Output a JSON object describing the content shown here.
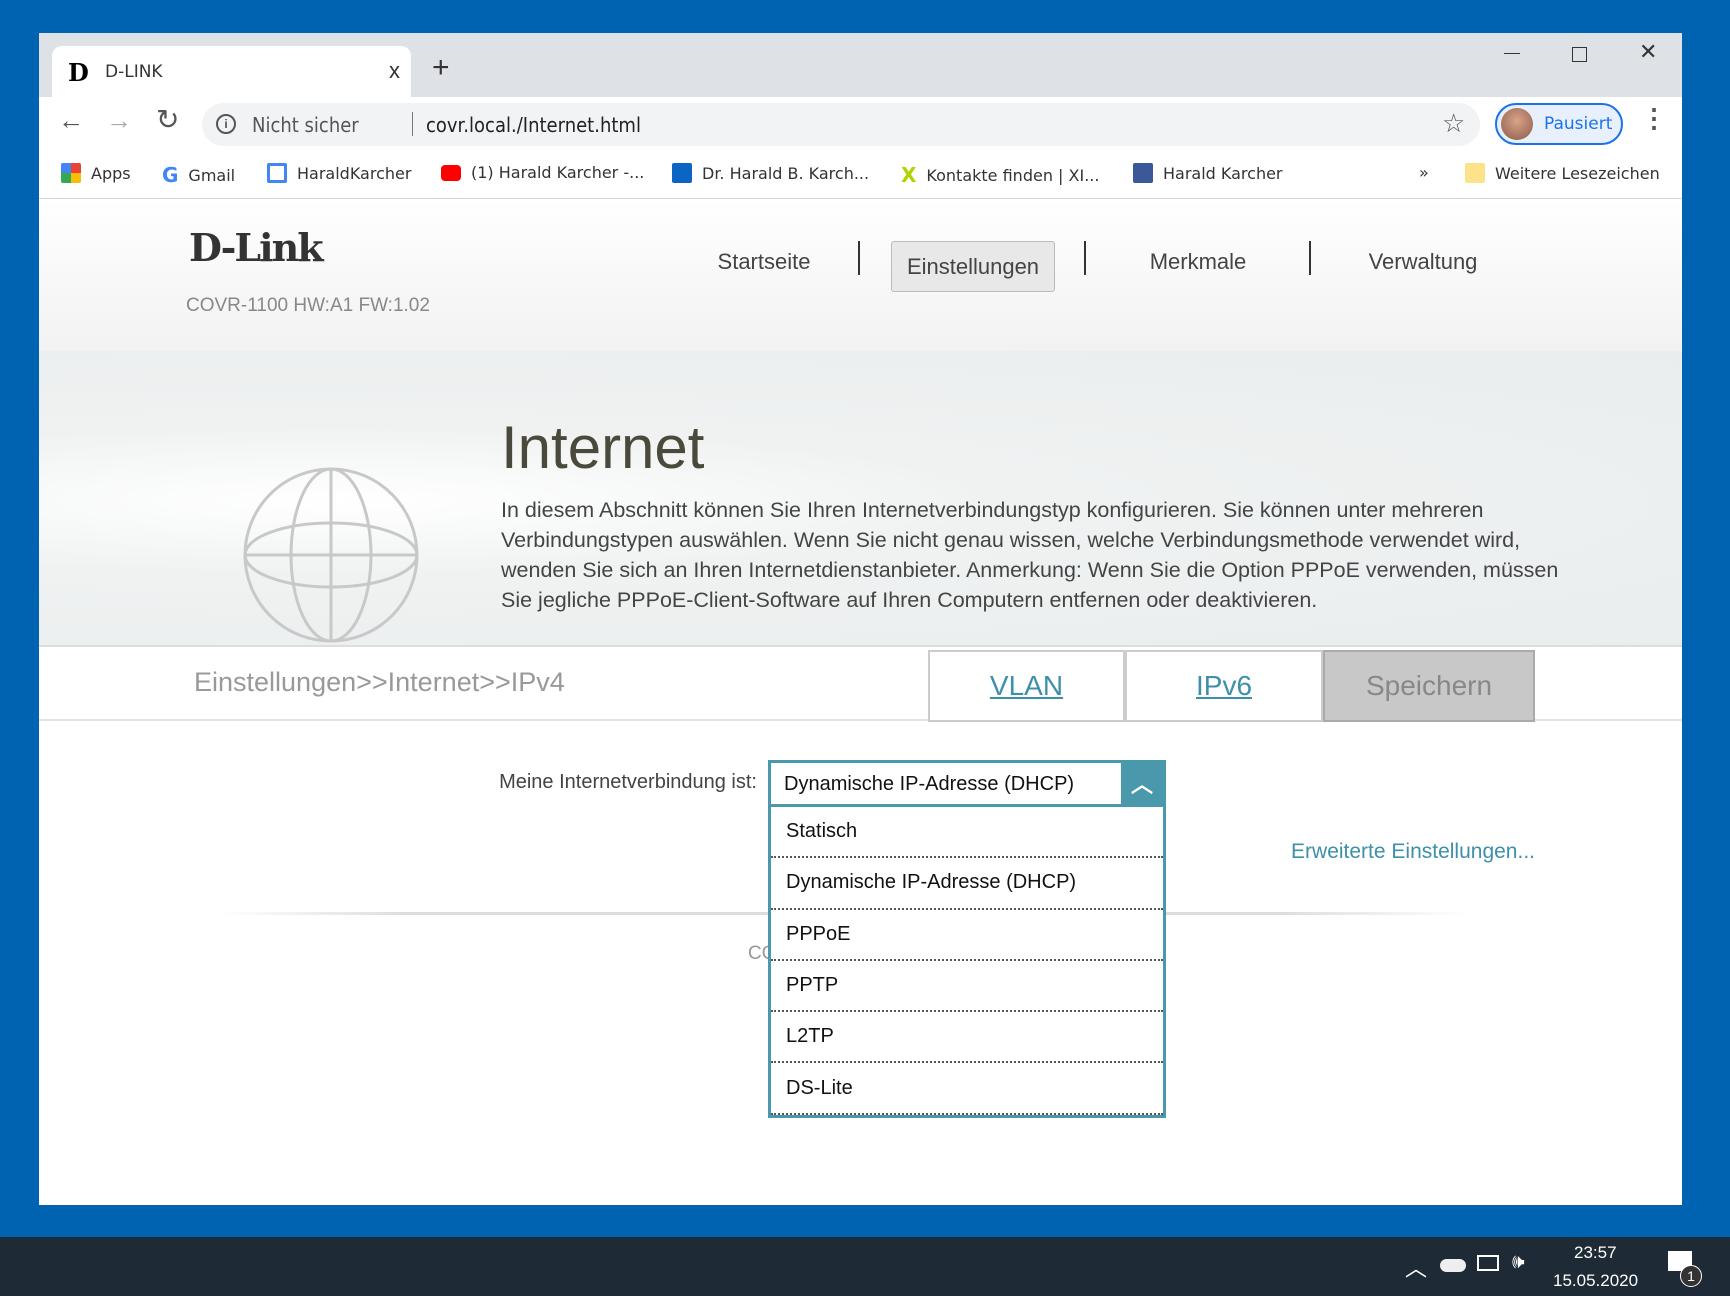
{
  "browser": {
    "tab_title": "D-LINK",
    "tab_close": "x",
    "new_tab": "+",
    "security": "Nicht sicher",
    "url": "covr.local./Internet.html",
    "profile_label": "Pausiert",
    "overflow": "»",
    "bookmarks": [
      {
        "label": "Apps",
        "icon": "apps-grid-icon"
      },
      {
        "label": "Gmail",
        "icon": "google-icon"
      },
      {
        "label": "HaraldKarcher",
        "icon": "site-icon"
      },
      {
        "label": "(1) Harald Karcher -...",
        "icon": "youtube-icon"
      },
      {
        "label": "Dr. Harald B. Karch...",
        "icon": "linkedin-icon"
      },
      {
        "label": "Kontakte finden | XI...",
        "icon": "xing-icon"
      },
      {
        "label": "Harald Karcher",
        "icon": "facebook-icon"
      }
    ],
    "other_bookmarks": "Weitere Lesezeichen"
  },
  "header": {
    "logo": "D-Link",
    "model": "COVR-1100 HW:A1 FW:1.02",
    "nav": [
      "Startseite",
      "Einstellungen",
      "Merkmale",
      "Verwaltung"
    ],
    "active_nav": "Einstellungen"
  },
  "banner": {
    "title": "Internet",
    "description": "In diesem Abschnitt können Sie Ihren Internetverbindungstyp konfigurieren. Sie können unter mehreren Verbindungstypen auswählen. Wenn Sie nicht genau wissen, welche Verbindungsmethode verwendet wird, wenden Sie sich an Ihren Internetdienstanbieter. Anmerkung: Wenn Sie die Option PPPoE verwenden, müssen Sie jegliche PPPoE-Client-Software auf Ihren Computern entfernen oder deaktivieren."
  },
  "crumb": {
    "path": "Einstellungen>>Internet>>IPv4",
    "vlan": "VLAN",
    "ipv6": "IPv6",
    "save": "Speichern"
  },
  "form": {
    "label": "Meine Internetverbindung ist:",
    "selected": "Dynamische IP-Adresse (DHCP)",
    "options": [
      "Statisch",
      "Dynamische IP-Adresse (DHCP)",
      "PPPoE",
      "PPTP",
      "L2TP",
      "DS-Lite"
    ],
    "advanced": "Erweiterte Einstellungen...",
    "footer_partial": "CO"
  },
  "taskbar": {
    "time": "23:57",
    "date": "15.05.2020",
    "notifications": "1"
  },
  "colors": {
    "accent": "#4a98ab",
    "desktop": "#0063b1",
    "taskbar": "#1e2a36"
  }
}
